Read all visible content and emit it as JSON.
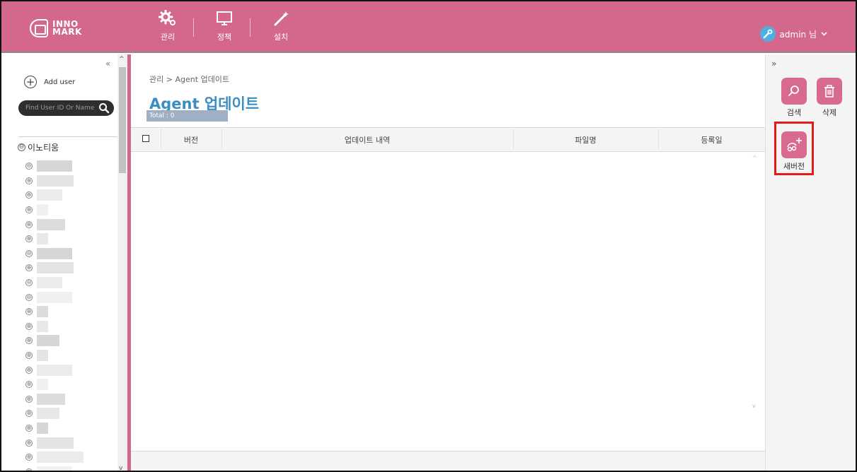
{
  "app": {
    "logo_text_1": "INNO",
    "logo_text_2": "MARK"
  },
  "topnav": {
    "items": [
      {
        "label": "관리",
        "icon": "gear-icon"
      },
      {
        "label": "정책",
        "icon": "monitor-icon"
      },
      {
        "label": "설치",
        "icon": "wand-icon"
      }
    ],
    "user_label": "admin 님",
    "user_icon": "wrench-icon"
  },
  "sidebar": {
    "collapse_icon": "«",
    "add_user_label": "Add user",
    "search_placeholder": "Find User ID Or Name",
    "tree_root_label": "이노티움",
    "tree_root_state": "⊖",
    "tree_states": [
      "⊖",
      "⊕",
      "⊕",
      "⊕",
      "⊕",
      "⊕",
      "⊖",
      "⊕",
      "⊖",
      "⊖",
      "⊕",
      "⊕",
      "⊕",
      "⊕",
      "⊕",
      "⊕",
      "⊕",
      "⊕",
      "⊕",
      "⊕",
      "⊕",
      "⊕"
    ]
  },
  "main": {
    "breadcrumb": "관리 > Agent 업데이트",
    "title": "Agent 업데이트",
    "total": "Total : 0",
    "columns": [
      "버전",
      "업데이트 내역",
      "파일명",
      "등록일"
    ],
    "rows": []
  },
  "rightpanel": {
    "collapse_icon": "»",
    "search_label": "검색",
    "delete_label": "삭제",
    "new_version_label": "새버전"
  },
  "colors": {
    "brand": "#d4688c",
    "title": "#3b8ec2",
    "highlight": "#e41b1b"
  }
}
